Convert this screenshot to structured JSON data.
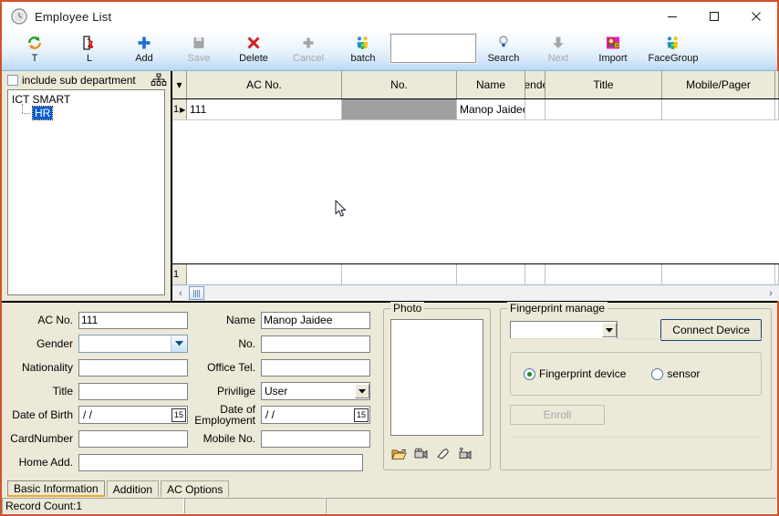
{
  "window": {
    "title": "Employee List",
    "icon": "clock-icon",
    "minimize": "—",
    "maximize": "☐",
    "close": "✕",
    "border_color": "#d2522a"
  },
  "toolbar": {
    "buttons": [
      {
        "label": "T",
        "icon": "refresh-icon",
        "enabled": true
      },
      {
        "label": "L",
        "icon": "exit-door-icon",
        "enabled": true
      },
      {
        "label": "Add",
        "icon": "plus-icon",
        "enabled": true
      },
      {
        "label": "Save",
        "icon": "save-icon",
        "enabled": false
      },
      {
        "label": "Delete",
        "icon": "delete-x-icon",
        "enabled": true
      },
      {
        "label": "Cancel",
        "icon": "cancel-plus-icon",
        "enabled": false
      },
      {
        "label": "batch",
        "icon": "batch-people-icon",
        "enabled": true
      }
    ],
    "search_box_value": "",
    "buttons_right": [
      {
        "label": "Search",
        "icon": "search-pin-icon",
        "enabled": true
      },
      {
        "label": "Next",
        "icon": "down-arrow-icon",
        "enabled": false
      },
      {
        "label": "Import",
        "icon": "import-icon",
        "enabled": true
      },
      {
        "label": "FaceGroup",
        "icon": "face-group-icon",
        "enabled": true
      }
    ]
  },
  "department": {
    "include_sub_label": "include sub department",
    "include_sub_checked": false,
    "org_icon": "org-chart-icon",
    "tree": {
      "root": "ICT SMART",
      "child": "HR",
      "child_selected": true,
      "selection_color": "#0a5fd3"
    }
  },
  "grid": {
    "columns": [
      "AC No.",
      "No.",
      "Name",
      "iende",
      "Title",
      "Mobile/Pager"
    ],
    "corner_icon": "▾",
    "rows": [
      {
        "number": "1",
        "marker": "▶",
        "ac_no": "111",
        "no": "",
        "name": "Manop Jaidee",
        "gender": "",
        "title": "",
        "mobile_pager": ""
      }
    ],
    "footer_row_number": "1",
    "scroll_left": "‹",
    "scroll_right": "›"
  },
  "form": {
    "ac_no_label": "AC No.",
    "ac_no_value": "111",
    "name_label": "Name",
    "name_value": "Manop Jaidee",
    "gender_label": "Gender",
    "gender_value": "",
    "no_label": "No.",
    "no_value": "",
    "nationality_label": "Nationality",
    "nationality_value": "",
    "office_tel_label": "Office Tel.",
    "office_tel_value": "",
    "title_label": "Title",
    "title_value": "",
    "privilige_label": "Privilige",
    "privilige_value": "User",
    "dob_label": "Date of Birth",
    "dob_value": "/  /",
    "doe_label_line1": "Date of",
    "doe_label_line2": "Employment",
    "doe_value": "/  /",
    "cardnumber_label": "CardNumber",
    "cardnumber_value": "",
    "mobile_no_label": "Mobile No.",
    "mobile_no_value": "",
    "home_add_label": "Home Add.",
    "home_add_value": "",
    "calendar_glyph": "15"
  },
  "photo": {
    "caption": "Photo",
    "icons": [
      "open-folder-icon",
      "capture-camera-icon",
      "eraser-icon",
      "video-camera-icon"
    ]
  },
  "fingerprint": {
    "caption": "Fingerprint manage",
    "device_value": "",
    "connect_label": "Connect Device",
    "radio_device_label": "Fingerprint device",
    "radio_sensor_label": "sensor",
    "radio_selected": "Fingerprint device",
    "enroll_label": "Enroll",
    "enroll_enabled": false,
    "radio_dot_color": "#1f8a1f"
  },
  "tabs": {
    "items": [
      "Basic Information",
      "Addition",
      "AC Options"
    ],
    "active": "Basic Information",
    "active_underline_color": "#f0a92c"
  },
  "statusbar": {
    "panel1": "Record Count:1",
    "panel2": "",
    "panel3": ""
  }
}
